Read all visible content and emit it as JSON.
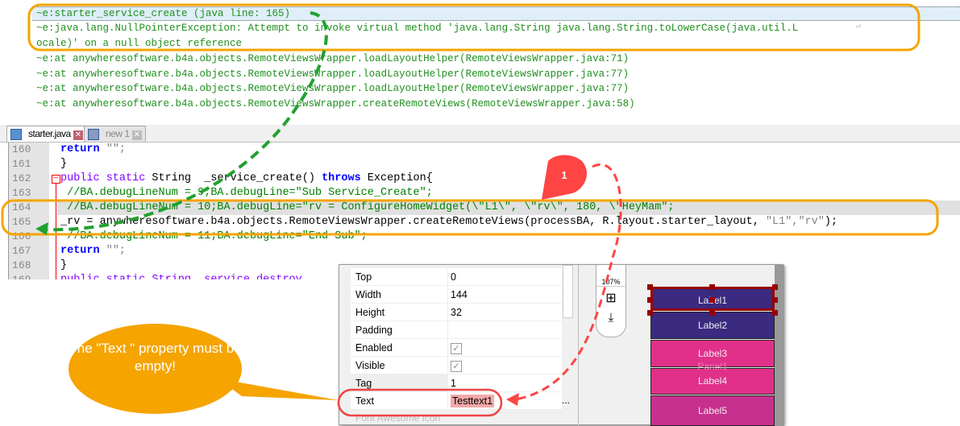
{
  "log": {
    "highlight": "~e:starter_service_create (java line: 165)",
    "lines": [
      "~e:java.lang.NullPointerException: Attempt to invoke virtual method 'java.lang.String java.lang.String.toLowerCase(java.util.L",
      "ocale)' on a null object reference",
      "~e:at anywheresoftware.b4a.objects.RemoteViewsWrapper.loadLayoutHelper(RemoteViewsWrapper.java:71)",
      "~e:at anywheresoftware.b4a.objects.RemoteViewsWrapper.loadLayoutHelper(RemoteViewsWrapper.java:77)",
      "~e:at anywheresoftware.b4a.objects.RemoteViewsWrapper.loadLayoutHelper(RemoteViewsWrapper.java:77)",
      "~e:at anywheresoftware.b4a.objects.RemoteViewsWrapper.createRemoteViews(RemoteViewsWrapper.java:58)"
    ],
    "wrap_icon": "⏎"
  },
  "tabs": [
    {
      "label": "starter.java"
    },
    {
      "label": "new 1"
    }
  ],
  "editor": {
    "line_numbers": [
      "160",
      "161",
      "162",
      "163",
      "164",
      "165",
      "166",
      "167",
      "168",
      "169"
    ],
    "c160a": "return",
    "c160b": " \"\";",
    "c161": "}",
    "c162a": "public static",
    "c162b": " String  _service_create() ",
    "c162c": "throws",
    "c162d": " Exception{",
    "c163": " //BA.debugLineNum = 9;BA.debugLine=\"Sub Service_Create\";",
    "c164": " //BA.debugLineNum = 10;BA.debugLine=\"rv = ConfigureHomeWidget(\\\"L1\\\", \\\"rv\\\", 180, \\\"HeyMam\";",
    "c165a": "_rv = anywheresoftware.b4a.objects.RemoteViewsWrapper.createRemoteViews(processBA, R.layout.starter_layout, ",
    "c165b": "\"L1\",\"rv\"",
    "c165c": ");",
    "c166": " //BA.debugLineNum = 11;BA.debugLine=\"End Sub\";",
    "c167a": "return",
    "c167b": " \"\";",
    "c168": "}",
    "c169": "public static String _service_destroy"
  },
  "properties": [
    {
      "key": "Top",
      "value": "0",
      "dropdown": true
    },
    {
      "key": "Width",
      "value": "144",
      "dropdown": true
    },
    {
      "key": "Height",
      "value": "32",
      "dropdown": true
    },
    {
      "key": "Padding",
      "value": ""
    },
    {
      "key": "Enabled",
      "checked": true
    },
    {
      "key": "Visible",
      "checked": true
    },
    {
      "key": "Tag",
      "value": "1"
    },
    {
      "key": "Text",
      "value": "Testtext1",
      "more": "..."
    }
  ],
  "props_partial": "Font Awesome Icon",
  "designer": {
    "zoom": "107%",
    "labels": [
      "Label1",
      "Label2",
      "Label3",
      "Label4",
      "Label5"
    ],
    "hidden_label": "Panel1",
    "colors": {
      "purple": "#3a2a80",
      "pink": "#e0308a",
      "magenta": "#c8308e"
    }
  },
  "annotations": {
    "callout": "The \"Text \" property must be empty!",
    "marker": "1",
    "accent_orange": "#f5a400",
    "accent_green": "#22a030",
    "accent_red": "#ff4444"
  }
}
